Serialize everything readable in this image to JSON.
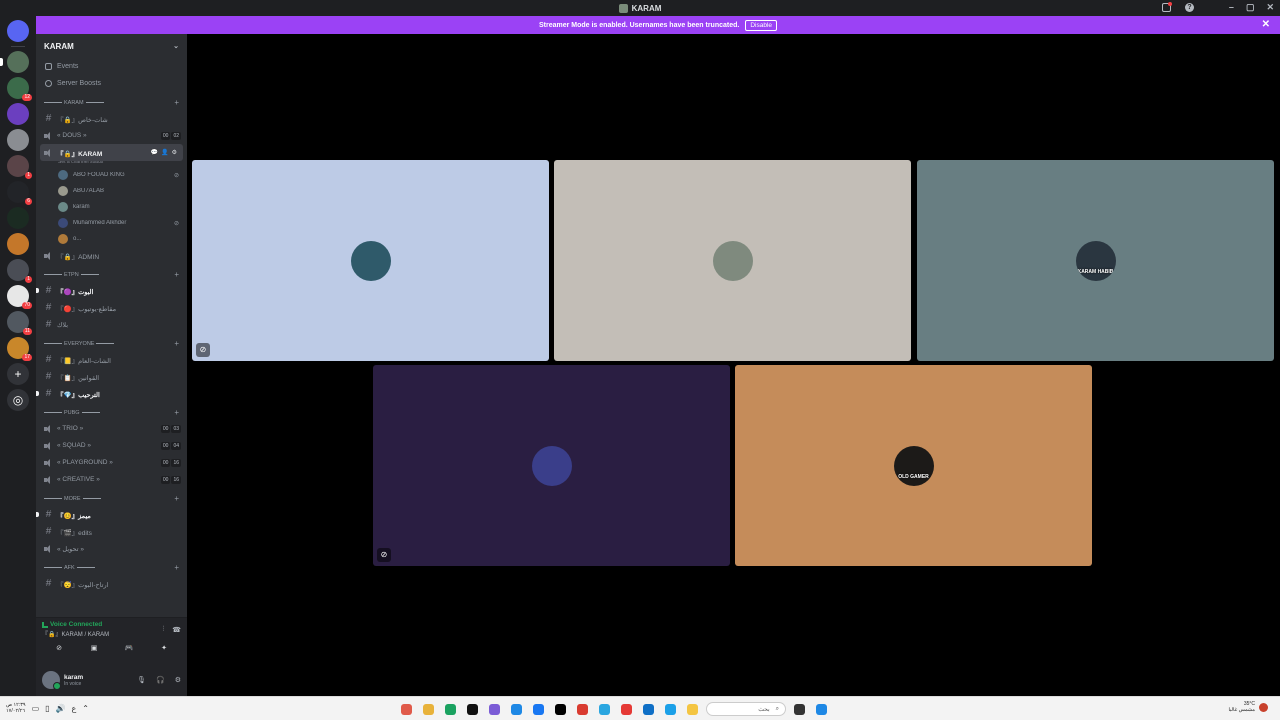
{
  "window": {
    "title": "KARAM"
  },
  "banner": {
    "text": "Streamer Mode is enabled. Usernames have been truncated.",
    "button": "Disable"
  },
  "rail": {
    "servers": [
      {
        "color": "#5865f2",
        "badge": "1"
      },
      {
        "color": "#55705a",
        "badge": "",
        "active": true
      },
      {
        "color": "#3b6b4a",
        "badge": "12"
      },
      {
        "color": "#6b3fbf",
        "badge": ""
      },
      {
        "color": "#8a8d92",
        "badge": ""
      },
      {
        "color": "#5a4448",
        "badge": "1"
      },
      {
        "color": "#222428",
        "badge": "6"
      },
      {
        "color": "#1b2b22",
        "badge": ""
      },
      {
        "color": "#c4772a",
        "badge": ""
      },
      {
        "color": "#4a4d55",
        "badge": "1"
      },
      {
        "color": "#e7e7e7",
        "badge": "70"
      },
      {
        "color": "#515860",
        "badge": "11"
      },
      {
        "color": "#c9872a",
        "badge": "17"
      }
    ]
  },
  "sidebar": {
    "server_name": "KARAM",
    "nav": {
      "events": "Events",
      "boosts": "Server Boosts"
    },
    "categories": {
      "karam": "KARAM",
      "etpn": "ETPN",
      "everyone": "EVERYONE",
      "pubg": "PUBG",
      "more": "MORE",
      "afk": "AFK"
    },
    "channels": {
      "c1": "『🔒』شات-خاص",
      "duos": "« DOUS »",
      "duos_counts": [
        "00",
        "02"
      ],
      "karam_voice": "『🔒』KARAM",
      "channel_status_hint": "Set a channel status",
      "admin": "『🔒』ADMIN",
      "etpn1": "『🟣』البوت",
      "etpn2": "『🔴』مقاطع-يوتيوب",
      "etpn3": "بلاك",
      "ev1": "『📒』الشات-العام",
      "ev2": "『📋』القوانين",
      "ev3": "『💎』الترحيب",
      "trio": "« TRIO »",
      "trio_counts": [
        "00",
        "03"
      ],
      "squad": "« SQUAD »",
      "squad_counts": [
        "00",
        "04"
      ],
      "playground": "« PLAYGROUND »",
      "playground_counts": [
        "00",
        "16"
      ],
      "creative": "« CREATIVE »",
      "creative_counts": [
        "00",
        "16"
      ],
      "more1": "『😊』ميمز",
      "more2": "『🎬』edits",
      "more3": "« تحويل »",
      "afk1": "『😴』ارتاح-البوت"
    },
    "voice_members": [
      {
        "name": "ABO FOUAD KING",
        "muted": true,
        "color": "#4d6a80"
      },
      {
        "name": "ABU7ALAB",
        "muted": false,
        "color": "#9a9a8e"
      },
      {
        "name": "karam",
        "muted": false,
        "color": "#6b8a88"
      },
      {
        "name": "Muhammed Alkhder",
        "muted": true,
        "color": "#3b4a78"
      },
      {
        "name": "o...",
        "muted": false,
        "color": "#b07a3a"
      }
    ]
  },
  "voice_panel": {
    "status": "Voice Connected",
    "location": "『🔒』KARAM / KARAM"
  },
  "user_panel": {
    "name": "karam",
    "status": "In voice"
  },
  "stage": {
    "tiles": [
      {
        "bg": "#bdcbe6",
        "avatar": "#2f5a6a",
        "label": "",
        "muted": true
      },
      {
        "bg": "#c3beb7",
        "avatar": "#7f8a7e",
        "label": "",
        "muted": false
      },
      {
        "bg": "#687e82",
        "avatar": "#2a3640",
        "label": "KARAM HABIB",
        "muted": false
      },
      {
        "bg": "#2a1e42",
        "avatar": "#3a3e8a",
        "label": "",
        "muted": true
      },
      {
        "bg": "#c58c5a",
        "avatar": "#1c1a18",
        "label": "OLD GAMER",
        "muted": false
      }
    ]
  },
  "taskbar": {
    "clock_time": "١٢:٣٩ ص",
    "clock_date": "١٧/٠٢/٢٦",
    "search_placeholder": "بحث",
    "weather_temp": "35°C",
    "weather_text": "مشمس غالبا",
    "apps": [
      "#e05a4a",
      "#e8b23a",
      "#1aa260",
      "#111111",
      "#7b5cd6",
      "#1e88e5",
      "#1877f2",
      "#000000",
      "#d93b30",
      "#2aa6e0",
      "#e53935",
      "#0f6fc6",
      "#1ba0e8",
      "#f4c542",
      "#333333"
    ]
  }
}
